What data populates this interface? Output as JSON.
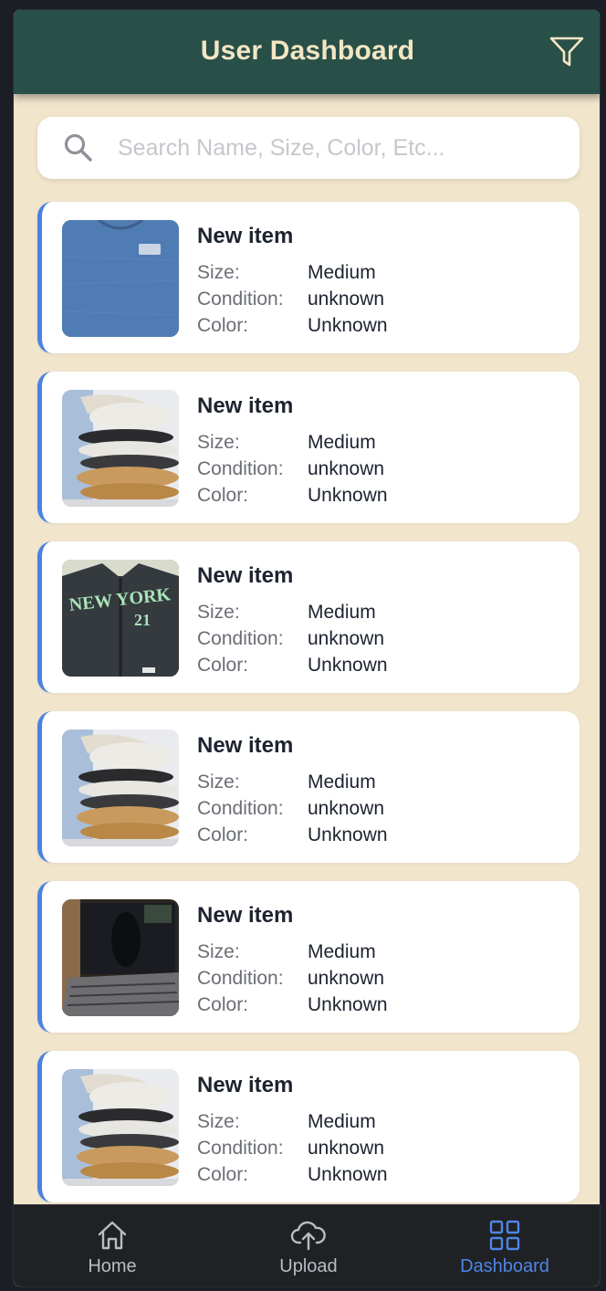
{
  "header": {
    "title": "User Dashboard",
    "filter_icon": "filter-icon"
  },
  "search": {
    "placeholder": "Search Name, Size, Color, Etc...",
    "icon": "search-icon"
  },
  "items": [
    {
      "title": "New item",
      "image": "blue-tshirt",
      "size_label": "Size:",
      "size": "Medium",
      "condition_label": "Condition:",
      "condition": "unknown",
      "color_label": "Color:",
      "color": "Unknown"
    },
    {
      "title": "New item",
      "image": "folded-clothes",
      "size_label": "Size:",
      "size": "Medium",
      "condition_label": "Condition:",
      "condition": "unknown",
      "color_label": "Color:",
      "color": "Unknown"
    },
    {
      "title": "New item",
      "image": "new-york-jacket",
      "jacket_text": "NEW YORK",
      "jacket_number": "21",
      "size_label": "Size:",
      "size": "Medium",
      "condition_label": "Condition:",
      "condition": "unknown",
      "color_label": "Color:",
      "color": "Unknown"
    },
    {
      "title": "New item",
      "image": "folded-clothes",
      "size_label": "Size:",
      "size": "Medium",
      "condition_label": "Condition:",
      "condition": "unknown",
      "color_label": "Color:",
      "color": "Unknown"
    },
    {
      "title": "New item",
      "image": "laptop",
      "size_label": "Size:",
      "size": "Medium",
      "condition_label": "Condition:",
      "condition": "unknown",
      "color_label": "Color:",
      "color": "Unknown"
    },
    {
      "title": "New item",
      "image": "folded-clothes",
      "size_label": "Size:",
      "size": "Medium",
      "condition_label": "Condition:",
      "condition": "unknown",
      "color_label": "Color:",
      "color": "Unknown"
    }
  ],
  "tabs": [
    {
      "label": "Home",
      "icon": "home-icon",
      "active": false
    },
    {
      "label": "Upload",
      "icon": "cloud-upload-icon",
      "active": false
    },
    {
      "label": "Dashboard",
      "icon": "dashboard-grid-icon",
      "active": true
    }
  ],
  "colors": {
    "header_bg": "#285048",
    "header_text": "#f3e6c4",
    "page_bg": "#f1e5cc",
    "card_accent": "#4a82e4",
    "tab_active": "#4f86e6",
    "tabbar_bg": "#1f2125"
  }
}
